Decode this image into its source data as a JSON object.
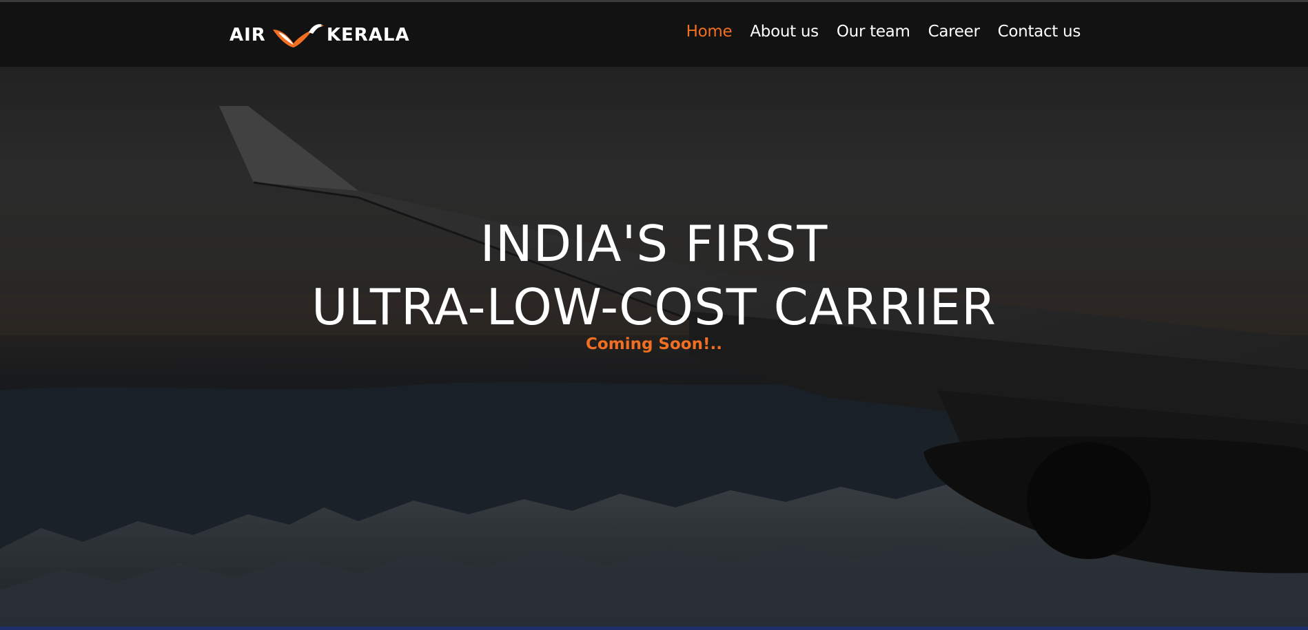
{
  "brand": {
    "left": "AIR",
    "right": "KERALA",
    "logo_icon": "bird-logo-icon",
    "accent_color": "#f26f21"
  },
  "nav": {
    "items": [
      {
        "label": "Home",
        "active": true
      },
      {
        "label": "About us",
        "active": false
      },
      {
        "label": "Our team",
        "active": false
      },
      {
        "label": "Career",
        "active": false
      },
      {
        "label": "Contact us",
        "active": false
      }
    ]
  },
  "hero": {
    "line1": "INDIA'S FIRST",
    "line2": "ULTRA-LOW-COST CARRIER",
    "tagline": "Coming Soon!.."
  }
}
